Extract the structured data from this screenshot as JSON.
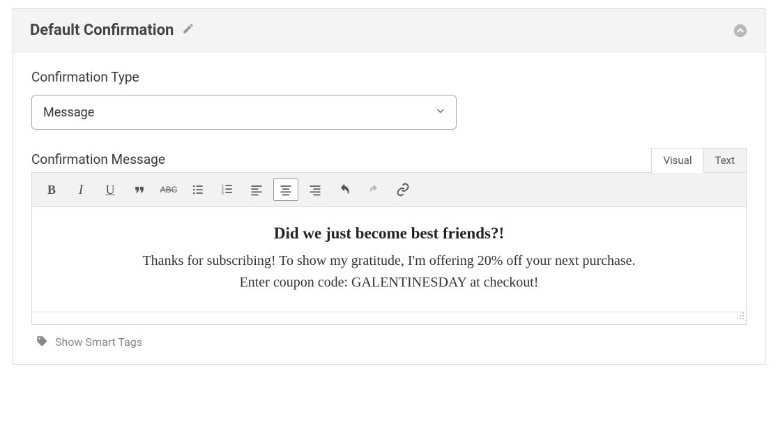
{
  "panel": {
    "title": "Default Confirmation"
  },
  "fields": {
    "type_label": "Confirmation Type",
    "type_value": "Message",
    "message_label": "Confirmation Message"
  },
  "editor_tabs": {
    "visual": "Visual",
    "text": "Text"
  },
  "message": {
    "heading": "Did we just become best friends?!",
    "line1": "Thanks for subscribing! To show my gratitude, I'm offering 20% off your next purchase.",
    "line2": "Enter coupon code: GALENTINESDAY at checkout!"
  },
  "smart_tags": {
    "label": "Show Smart Tags"
  }
}
